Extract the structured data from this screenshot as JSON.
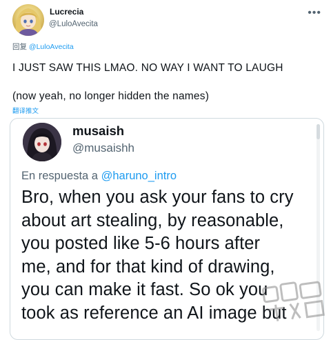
{
  "main_tweet": {
    "display_name": "Lucrecia",
    "handle": "@LuloAvecita",
    "more_icon": "more-horizontal-icon",
    "reply_prefix": "回复",
    "reply_to": "@LuloAvecita",
    "text_line_1": "I JUST SAW THIS LMAO.  NO WAY I WANT TO LAUGH",
    "text_line_2": "(now yeah, no longer hidden the names)",
    "translate_label": "翻译推文"
  },
  "quoted_tweet": {
    "display_name": "musaish",
    "handle": "@musaishh",
    "reply_prefix": "En respuesta a",
    "reply_to": "@haruno_intro",
    "body_lines": [
      "Bro, when you ask your fans to cry",
      "about art stealing, by reasonable,",
      "you posted like 5-6 hours after",
      "me, and for that kind of drawing,",
      "you can make it fast. So ok you",
      "took as reference an AI image but"
    ]
  },
  "colors": {
    "text_primary": "#0f1419",
    "text_secondary": "#536471",
    "link": "#1d9bf0",
    "border": "#cfd9de"
  }
}
